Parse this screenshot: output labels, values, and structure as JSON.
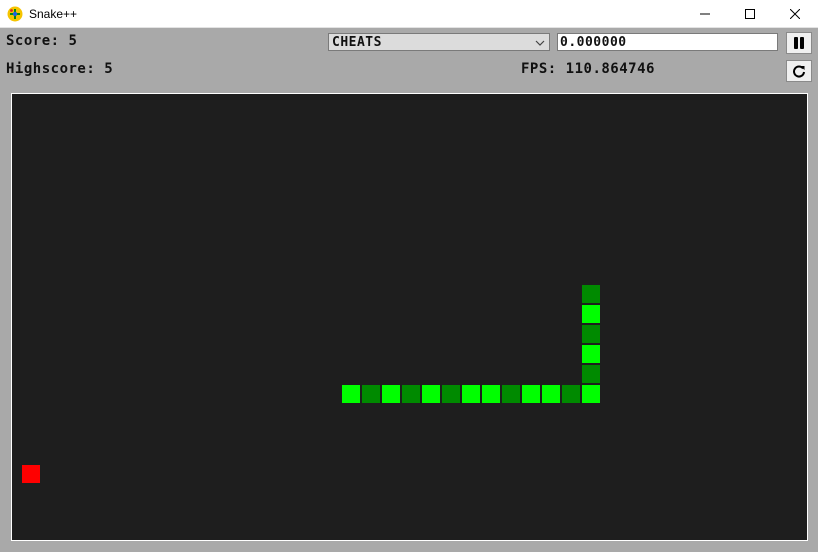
{
  "window": {
    "title": "Snake++",
    "icon": "game-icon",
    "controls": [
      "minimize-icon",
      "maximize-icon",
      "close-icon"
    ]
  },
  "hud": {
    "score_label": "Score:",
    "score_value": "5",
    "highscore_label": "Highscore:",
    "highscore_value": "5",
    "fps_label": "FPS:",
    "fps_value": "110.864746"
  },
  "controls": {
    "cheats_select": {
      "selected": "CHEATS"
    },
    "cheat_input": {
      "value": "0.000000"
    },
    "pause_button": {
      "icon": "pause-icon"
    },
    "restart_button": {
      "icon": "restart-icon"
    }
  },
  "colors": {
    "board_bg": "#1e1e1e",
    "snake_light": "#00ff00",
    "snake_dark": "#008a00",
    "food": "#ff0000"
  },
  "game": {
    "grid": {
      "cols": 40,
      "rows": 22
    },
    "food": {
      "col": 0,
      "row": 18
    },
    "snake": [
      {
        "col": 28,
        "row": 9,
        "shade": "dark"
      },
      {
        "col": 28,
        "row": 10,
        "shade": "light"
      },
      {
        "col": 28,
        "row": 11,
        "shade": "dark"
      },
      {
        "col": 28,
        "row": 12,
        "shade": "light"
      },
      {
        "col": 28,
        "row": 13,
        "shade": "dark"
      },
      {
        "col": 28,
        "row": 14,
        "shade": "light"
      },
      {
        "col": 27,
        "row": 14,
        "shade": "dark"
      },
      {
        "col": 26,
        "row": 14,
        "shade": "light"
      },
      {
        "col": 25,
        "row": 14,
        "shade": "light"
      },
      {
        "col": 24,
        "row": 14,
        "shade": "dark"
      },
      {
        "col": 23,
        "row": 14,
        "shade": "light"
      },
      {
        "col": 22,
        "row": 14,
        "shade": "light"
      },
      {
        "col": 21,
        "row": 14,
        "shade": "dark"
      },
      {
        "col": 20,
        "row": 14,
        "shade": "light"
      },
      {
        "col": 19,
        "row": 14,
        "shade": "dark"
      },
      {
        "col": 18,
        "row": 14,
        "shade": "light"
      },
      {
        "col": 17,
        "row": 14,
        "shade": "dark"
      },
      {
        "col": 16,
        "row": 14,
        "shade": "light"
      }
    ]
  }
}
